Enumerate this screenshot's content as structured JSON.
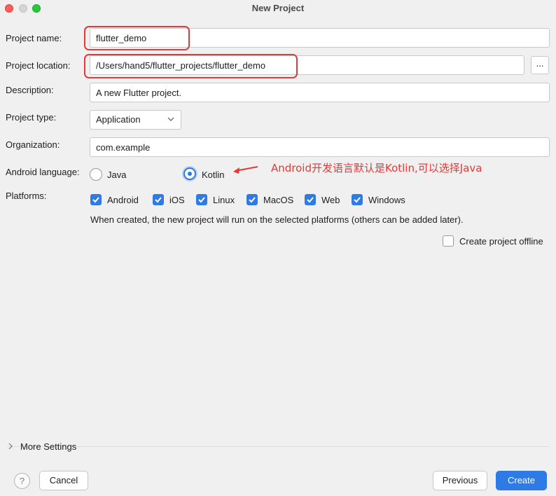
{
  "window": {
    "title": "New Project"
  },
  "form": {
    "project_name_label": "Project name:",
    "project_name_value": "flutter_demo",
    "project_location_label": "Project location:",
    "project_location_value": "/Users/hand5/flutter_projects/flutter_demo",
    "browse_label": "...",
    "description_label": "Description:",
    "description_value": "A new Flutter project.",
    "project_type_label": "Project type:",
    "project_type_value": "Application",
    "organization_label": "Organization:",
    "organization_value": "com.example",
    "android_language_label": "Android language:",
    "language_options": [
      "Java",
      "Kotlin"
    ],
    "language_selected": "Kotlin",
    "platforms_label": "Platforms:",
    "platforms": [
      {
        "label": "Android",
        "checked": true
      },
      {
        "label": "iOS",
        "checked": true
      },
      {
        "label": "Linux",
        "checked": true
      },
      {
        "label": "MacOS",
        "checked": true
      },
      {
        "label": "Web",
        "checked": true
      },
      {
        "label": "Windows",
        "checked": true
      }
    ],
    "platforms_note": "When created, the new project will run on the selected platforms (others can be added later).",
    "offline_label": "Create project offline",
    "offline_checked": false
  },
  "annotation": {
    "text": "Android开发语言默认是Kotlin,可以选择Java",
    "color": "#e53935"
  },
  "footer": {
    "more_settings": "More Settings",
    "help": "?",
    "cancel": "Cancel",
    "previous": "Previous",
    "create": "Create"
  },
  "colors": {
    "accent": "#2f7be5",
    "highlight": "#e53935"
  }
}
